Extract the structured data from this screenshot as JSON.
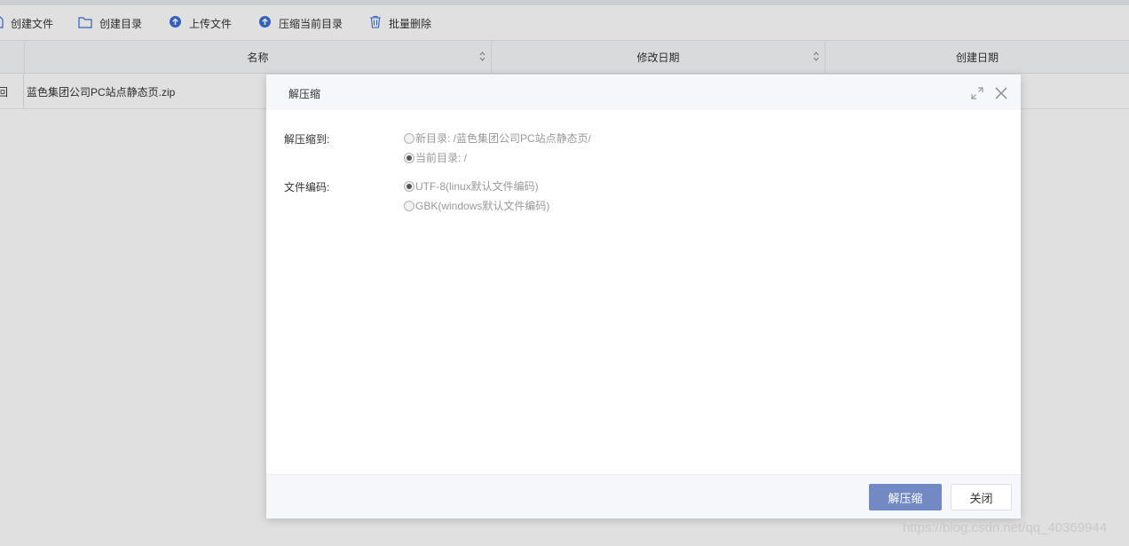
{
  "toolbar": {
    "items": [
      {
        "label": "创建文件",
        "icon": "file-icon"
      },
      {
        "label": "创建目录",
        "icon": "folder-icon"
      },
      {
        "label": "上传文件",
        "icon": "upload-icon"
      },
      {
        "label": "压缩当前目录",
        "icon": "upload-icon"
      },
      {
        "label": "批量删除",
        "icon": "trash-icon"
      }
    ]
  },
  "table": {
    "columns": [
      "名称",
      "修改日期",
      "创建日期"
    ],
    "rows": [
      {
        "icon_glyph": "回",
        "name": "蓝色集团公司PC站点静态页.zip"
      }
    ]
  },
  "dialog": {
    "title": "解压缩",
    "extract_to_label": "解压缩到:",
    "extract_options": [
      {
        "label": "新目录: /蓝色集团公司PC站点静态页/",
        "checked": false
      },
      {
        "label": "当前目录: /",
        "checked": true
      }
    ],
    "encoding_label": "文件编码:",
    "encoding_options": [
      {
        "label": "UTF-8(linux默认文件编码)",
        "checked": true
      },
      {
        "label": "GBK(windows默认文件编码)",
        "checked": false
      }
    ],
    "confirm_label": "解压缩",
    "close_label": "关闭"
  },
  "colors": {
    "primary_button": "#7289c3",
    "toolbar_icon": "#3a6fd8"
  },
  "watermark": "https://blog.csdn.net/qq_40369944"
}
